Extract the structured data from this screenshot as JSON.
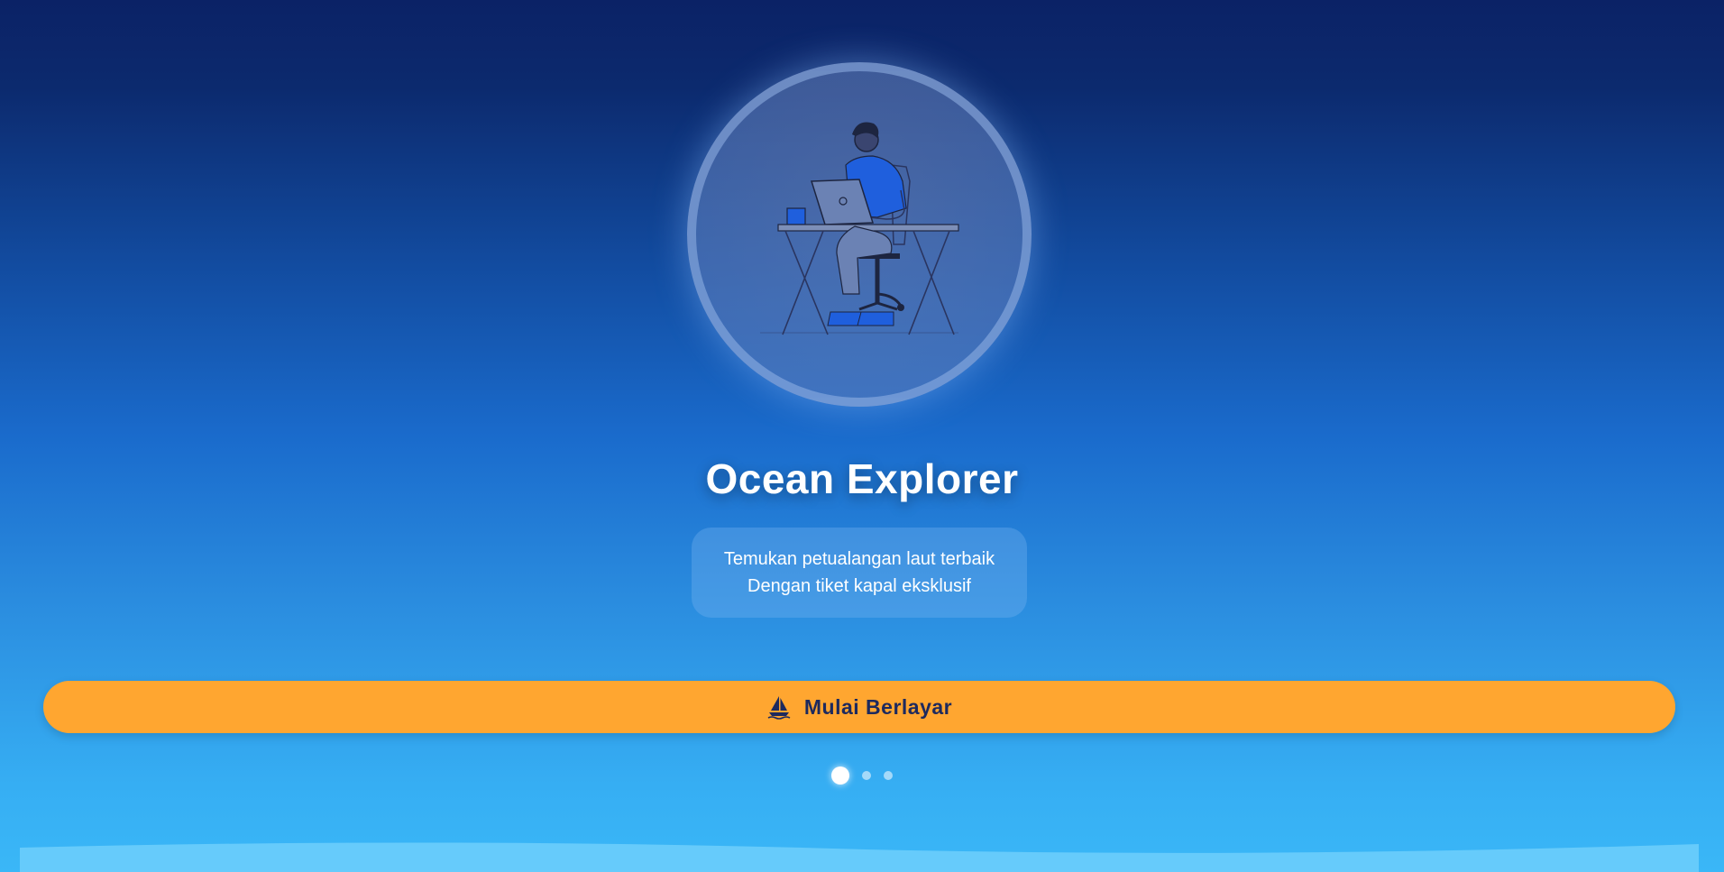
{
  "hero": {
    "illustration_icon": "person-at-desk-with-laptop-illustration"
  },
  "title": "Ocean Explorer",
  "tagline": {
    "line1": "Temukan petualangan laut terbaik",
    "line2": "Dengan tiket kapal eksklusif"
  },
  "cta": {
    "label": "Mulai Berlayar",
    "icon": "sailboat-icon"
  },
  "pagination": {
    "total": 3,
    "active_index": 0
  },
  "colors": {
    "accent": "#ffa630",
    "cta_text": "#1d2a5e",
    "bg_top": "#0b2266",
    "bg_bottom": "#3ab7f7"
  }
}
